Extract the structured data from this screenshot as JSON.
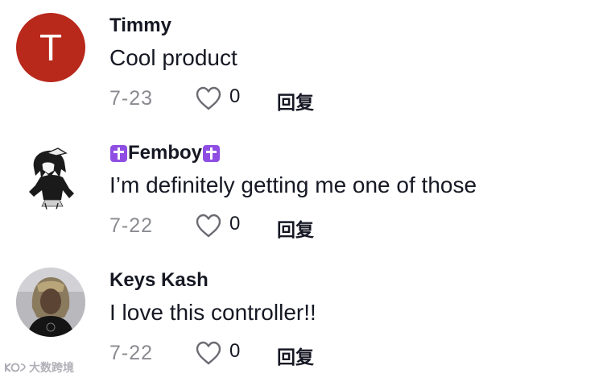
{
  "comments": [
    {
      "username": "Timmy",
      "avatar_letter": "T",
      "text": "Cool product",
      "date": "7-23",
      "likes": "0",
      "reply_label": "回复"
    },
    {
      "username": "Femboy",
      "username_decoration": "latin-cross-emoji",
      "text": "I’m definitely getting me one of those",
      "date": "7-22",
      "likes": "0",
      "reply_label": "回复"
    },
    {
      "username": "Keys Kash",
      "text": "I love this controller!!",
      "date": "7-22",
      "likes": "0",
      "reply_label": "回复"
    }
  ],
  "watermark": {
    "text": "大数跨境"
  },
  "colors": {
    "avatar_letter_bg": "#b8281b",
    "date_text": "#8a8b91",
    "cross_emoji_bg": "#8f4ee3"
  },
  "icons": {
    "like": "heart-outline-icon"
  }
}
